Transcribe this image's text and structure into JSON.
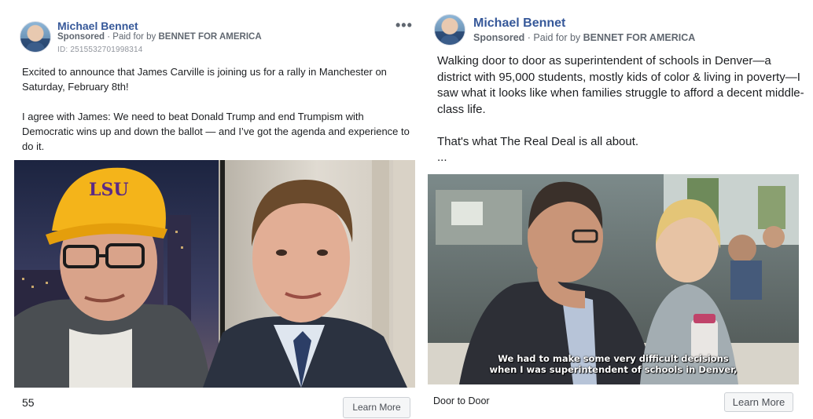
{
  "ads": [
    {
      "page_name": "Michael Bennet",
      "sponsored_label": "Sponsored",
      "paid_for_prefix": "Paid for by",
      "paid_for_name": "BENNET FOR AMERICA",
      "ad_id": "ID: 2515532701998314",
      "menu_glyph": "•••",
      "body": "Excited to announce that James Carville is joining us for a rally in Manchester on Saturday, February 8th!\n\nI agree with James: We need to beat Donald Trump and end Trumpism with Democratic wins up and down the ballot — and I’ve got the agenda and experience to do it.",
      "media_icon": "video-still-two-men",
      "footer_text": "55",
      "cta_label": "Learn More"
    },
    {
      "page_name": "Michael Bennet",
      "sponsored_label": "Sponsored",
      "paid_for_prefix": "Paid for by",
      "paid_for_name": "BENNET FOR AMERICA",
      "body": "Walking door to door as superintendent of schools in Denver—a district with 95,000 students, mostly kids of color & living in poverty—I saw what it looks like when families struggle to afford a decent middle-class life.\n\nThat's what The Real Deal is all about.\n...",
      "media_icon": "video-still-classroom",
      "subtitle": "We had to make some very difficult decisions\nwhen I was superintendent of schools in Denver,",
      "footer_text": "Door to Door",
      "cta_label": "Learn More"
    }
  ],
  "colors": {
    "name": "#365899",
    "meta": "#606770",
    "text": "#1c1e21",
    "cap_yellow": "#f4b41a"
  }
}
